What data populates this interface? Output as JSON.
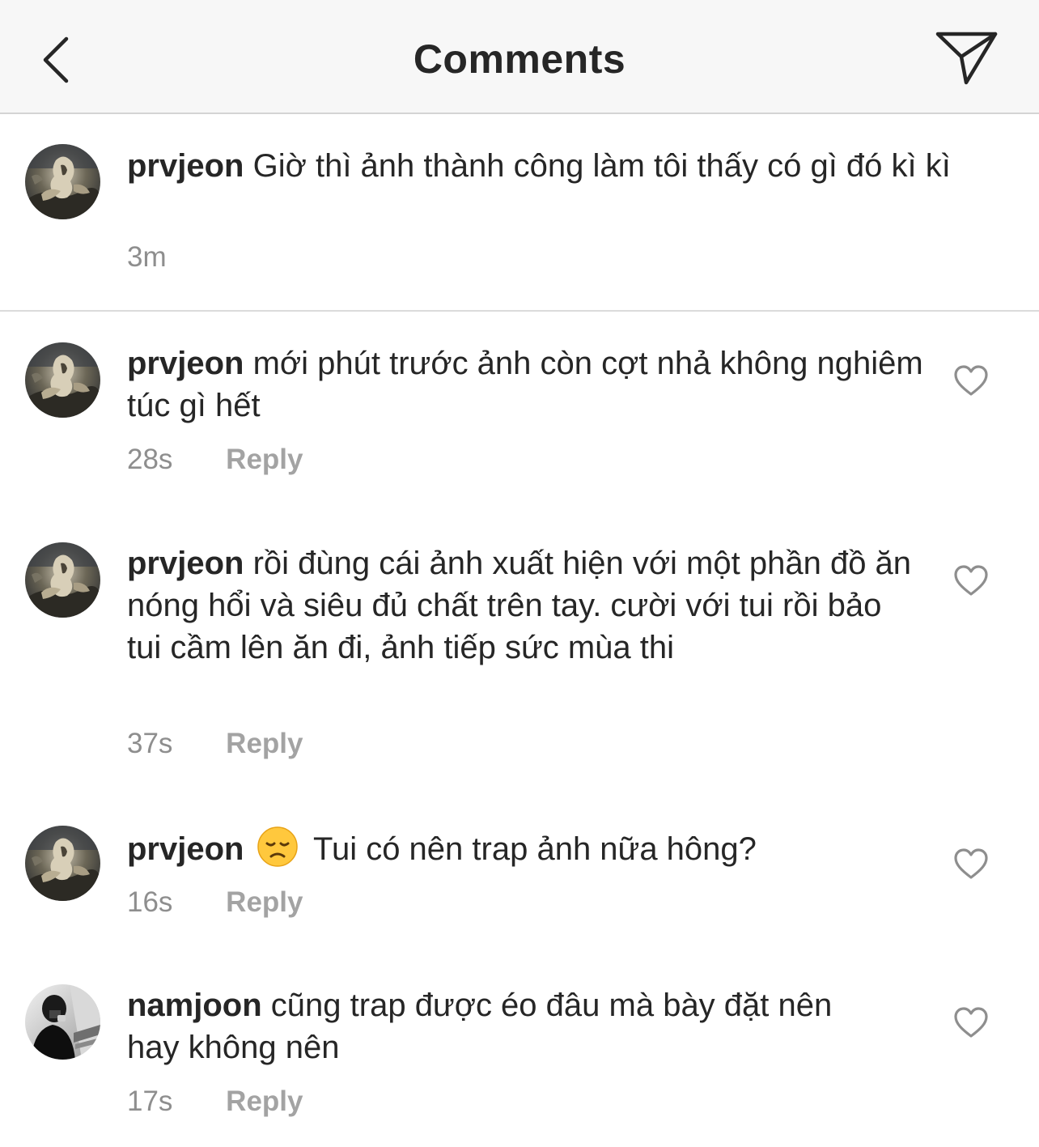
{
  "header": {
    "title": "Comments",
    "back_icon": "chevron-left-icon",
    "send_icon": "paper-plane-icon"
  },
  "caption": {
    "username": "prvjeon",
    "text": "Giờ thì ảnh thành công làm tôi thấy có gì đó kì kì",
    "time": "3m"
  },
  "comments": [
    {
      "username": "prvjeon",
      "text": "mới phút trước ảnh còn cợt nhả không nghiêm túc gì hết",
      "time": "28s",
      "reply_label": "Reply"
    },
    {
      "username": "prvjeon",
      "text": "rồi đùng cái ảnh xuất hiện với một phần đồ ăn nóng hổi và siêu đủ chất trên tay. cười với tui rồi bảo tui cầm lên ăn đi, ảnh tiếp sức mùa thi",
      "time": "37s",
      "reply_label": "Reply"
    },
    {
      "username": "prvjeon",
      "emoji": "disappointed-face-emoji",
      "text": "Tui có nên trap ảnh nữa hông?",
      "time": "16s",
      "reply_label": "Reply"
    },
    {
      "username": "namjoon",
      "text": "cũng trap được éo đâu mà bày đặt nên hay không nên",
      "time": "17s",
      "reply_label": "Reply"
    }
  ],
  "colors": {
    "header_bg": "#f7f7f7",
    "text": "#262626",
    "meta": "#8e8e8e",
    "divider": "#dbdbdb"
  }
}
